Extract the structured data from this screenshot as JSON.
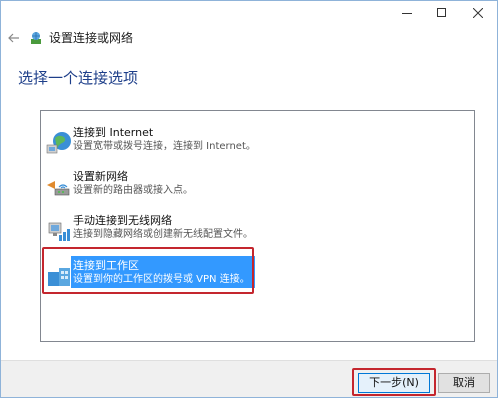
{
  "window": {
    "title": "设置连接或网络",
    "controls": {
      "minimize": "minimize-icon",
      "maximize": "maximize-icon",
      "close": "close-icon"
    }
  },
  "heading": "选择一个连接选项",
  "options": [
    {
      "title": "连接到 Internet",
      "desc": "设置宽带或拨号连接，连接到 Internet。",
      "icon": "globe-network-icon",
      "selected": false
    },
    {
      "title": "设置新网络",
      "desc": "设置新的路由器或接入点。",
      "icon": "router-icon",
      "selected": false
    },
    {
      "title": "手动连接到无线网络",
      "desc": "连接到隐藏网络或创建新无线配置文件。",
      "icon": "wireless-network-icon",
      "selected": false
    },
    {
      "title": "连接到工作区",
      "desc": "设置到你的工作区的拨号或 VPN 连接。",
      "icon": "workplace-icon",
      "selected": true
    }
  ],
  "buttons": {
    "next": "下一步(N)",
    "cancel": "取消"
  },
  "colors": {
    "heading": "#1e3f8a",
    "selection": "#3399ff",
    "highlight_frame": "#c4262e"
  }
}
